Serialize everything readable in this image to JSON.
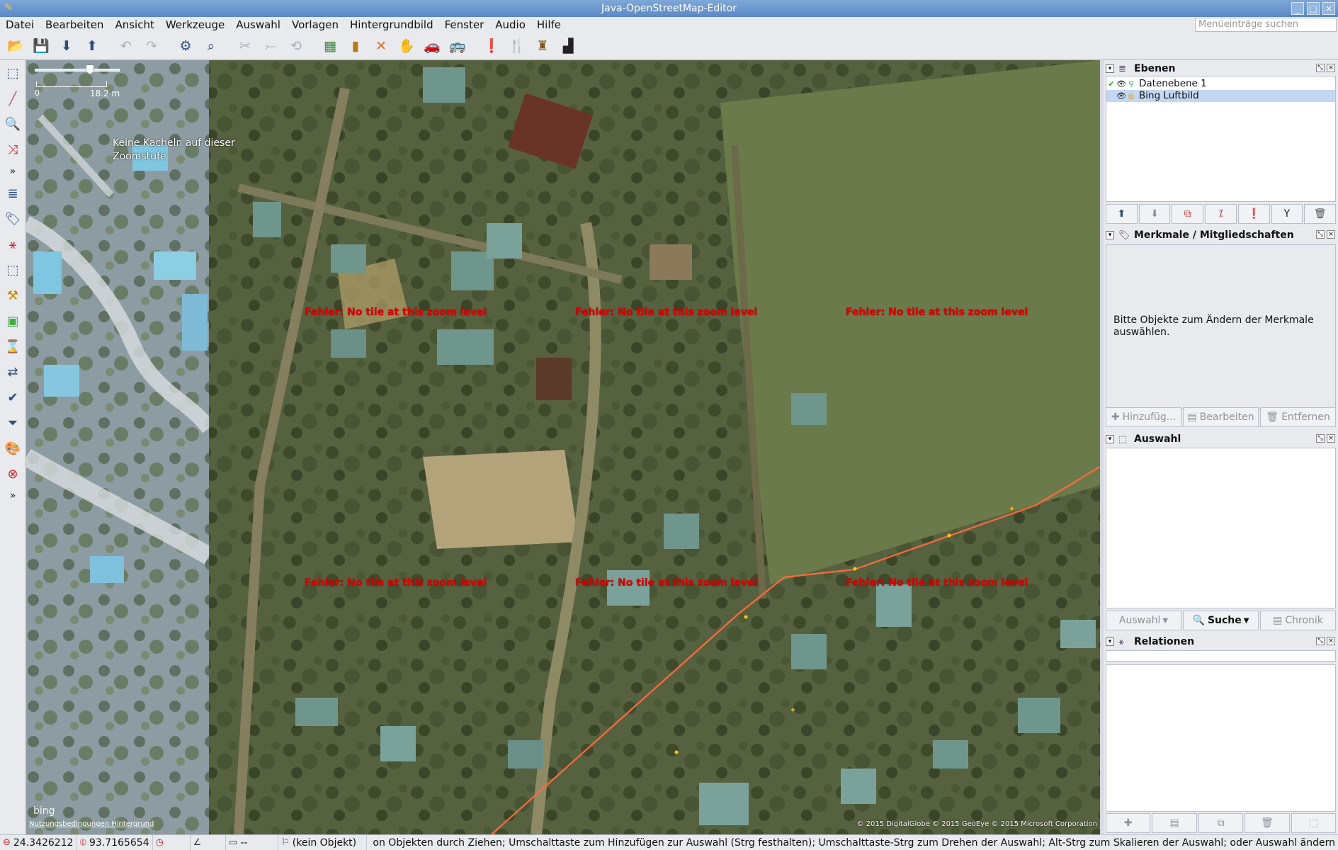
{
  "window": {
    "title": "Java-OpenStreetMap-Editor",
    "controls": [
      "_",
      "□",
      "×"
    ]
  },
  "menu": {
    "items": [
      "Datei",
      "Bearbeiten",
      "Ansicht",
      "Werkzeuge",
      "Auswahl",
      "Vorlagen",
      "Hintergrundbild",
      "Fenster",
      "Audio",
      "Hilfe"
    ],
    "search_placeholder": "Menüeinträge suchen"
  },
  "toolbar": {
    "icons": [
      "open-icon",
      "save-icon",
      "download-icon",
      "upload-icon",
      "undo-icon",
      "redo-icon",
      "preferences-icon",
      "search-icon",
      "split-way-icon",
      "combine-icon",
      "reverse-icon",
      "imagery-icon",
      "building-icon",
      "crossing-icon",
      "hand-icon",
      "car-icon",
      "bus-icon",
      "warning-icon",
      "amenity-icon",
      "castle-icon",
      "factory-icon"
    ]
  },
  "left_tools": {
    "more_label": "»"
  },
  "map": {
    "scale_zero": "0",
    "scale_label": "18.2 m",
    "no_tiles_text": "Keine Kacheln auf dieser Zoomstufe",
    "error_text": "Fehler: No tile at this zoom level",
    "bing_label": "bing",
    "terms_link": "Nutzungsbedingungen Hintergrund",
    "attribution": "© 2015 DigitalGlobe © 2015 GeoEye © 2015 Microsoft Corporation",
    "way_color": "#ff6a3d"
  },
  "panels": {
    "layers": {
      "title": "Ebenen",
      "items": [
        {
          "name": "Datenebene 1"
        },
        {
          "name": "Bing Luftbild"
        }
      ]
    },
    "tags": {
      "title": "Merkmale / Mitgliedschaften",
      "hint": "Bitte Objekte zum Ändern der Merkmale auswählen.",
      "buttons": [
        "Hinzufüg...",
        "Bearbeiten",
        "Entfernen"
      ]
    },
    "selection": {
      "title": "Auswahl",
      "buttons": [
        "Auswahl",
        "Suche",
        "Chronik"
      ]
    },
    "relations": {
      "title": "Relationen"
    }
  },
  "status": {
    "lat": "24.3426212",
    "lon": "93.7165654",
    "heading": "",
    "angle": "",
    "length": "--",
    "object": "(kein Objekt)",
    "help": "on Objekten durch Ziehen; Umschalttaste zum Hinzufügen zur Auswahl (Strg festhalten); Umschalttaste-Strg zum Drehen der Auswahl; Alt-Strg zum Skalieren der Auswahl; oder Auswahl ändern"
  }
}
